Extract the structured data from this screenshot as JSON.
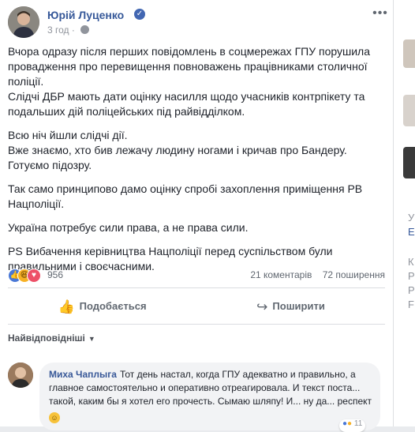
{
  "post": {
    "author": "Юрій Луценко",
    "time": "3 год",
    "paragraphs": [
      "Вчора одразу після перших повідомлень в соцмережах ГПУ порушила провадження про перевищення повноважень працівниками столичної поліції.\nСлідчі ДБР мають дати оцінку насилля щодо учасників контрпікету та подальших дій поліцейських під райвідділком.",
      "Всю ніч йшли слідчі дії.\nВже знаємо, хто бив лежачу людину ногами і кричав про Бандеру.\nГотуємо підозру.",
      "Так само принципово дамо оцінку спробі захоплення приміщення РВ Нацполіції.",
      "Україна потребує сили права, а не права сили.",
      "PS Вибачення керівництва Нацполіції перед суспільством були правильними і своєчасними."
    ],
    "reaction_count": "956",
    "comments_count": "21 коментарів",
    "shares_count": "72 поширення"
  },
  "actions": {
    "like": "Подобається",
    "share": "Поширити"
  },
  "comments_filter": "Найвідповідніші",
  "comment": {
    "author": "Миха Чаплыга",
    "text": "Тот день настал, когда ГПУ адекватно и правильно, а главное самостоятельно и оперативно отреагировала. И текст поста... такой, каким бы я хотел его прочесть. Сымаю шляпу! И... ну да... респект",
    "reaction_count": "11"
  },
  "sidebar": {
    "letters": [
      "У",
      "Е",
      "К",
      "Р",
      "Р",
      "F"
    ]
  },
  "colors": {
    "link": "#365899",
    "background": "#e9ebee"
  }
}
